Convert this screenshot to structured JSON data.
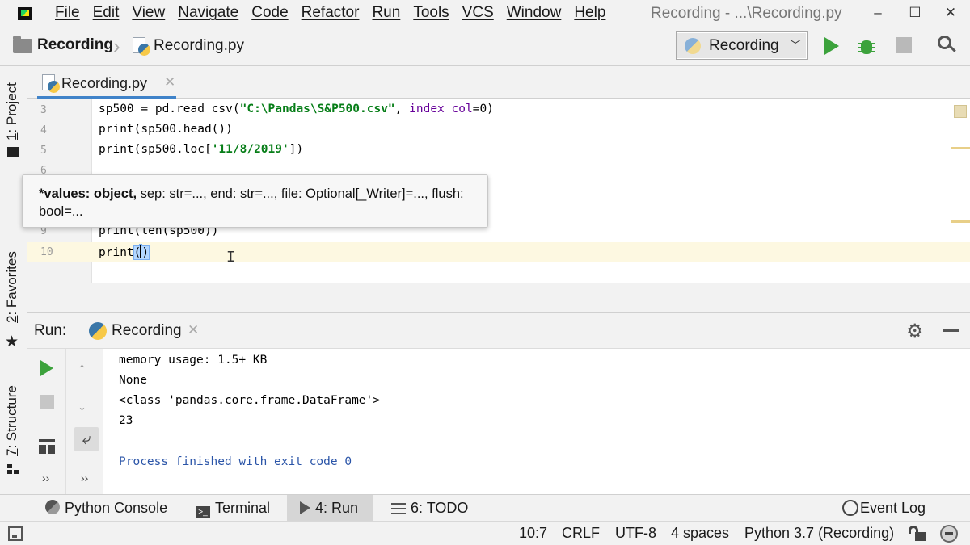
{
  "menu": {
    "items": [
      "File",
      "Edit",
      "View",
      "Navigate",
      "Code",
      "Refactor",
      "Run",
      "Tools",
      "VCS",
      "Window",
      "Help"
    ]
  },
  "window": {
    "title": "Recording - ...\\Recording.py",
    "minimize": "–",
    "maximize": "☐",
    "close": "✕"
  },
  "navbar": {
    "project": "Recording",
    "file": "Recording.py",
    "run_config": "Recording"
  },
  "left_strip": {
    "project_tab": {
      "num": "1",
      "label": ": Project"
    },
    "favorites_tab": {
      "num": "2",
      "label": ": Favorites"
    },
    "structure_tab": {
      "num": "7",
      "label": ": Structure"
    }
  },
  "editor": {
    "tab_label": "Recording.py",
    "line_numbers": [
      "3",
      "4",
      "5",
      "6",
      "",
      "",
      "9",
      "10"
    ],
    "lines": {
      "l3": {
        "pre": "sp500 = pd.read_csv(",
        "str": "\"C:\\Pandas\\S&P500.csv\"",
        "mid": ", ",
        "param": "index_col",
        "post": "=0)"
      },
      "l4": "print(sp500.head())",
      "l5": {
        "pre": "print(sp500.loc[",
        "str": "'11/8/2019'",
        "post": "])"
      },
      "l9": "print(len(sp500))",
      "l10_fn": "print",
      "l10_open": "(",
      "l10_close": ")"
    }
  },
  "param_popup": {
    "bold": "*values: object,",
    "rest": " sep: str=..., end: str=..., file: Optional[_Writer]=..., flush: bool=..."
  },
  "run_panel": {
    "label": "Run:",
    "tab": "Recording",
    "console": [
      "memory usage: 1.5+ KB",
      "None",
      "<class 'pandas.core.frame.DataFrame'>",
      "23",
      "",
      "Process finished with exit code 0"
    ]
  },
  "tool_tabs": {
    "python_console": "Python Console",
    "terminal": "Terminal",
    "run_num": "4",
    "run_label": ": Run",
    "todo_num": "6",
    "todo_label": ": TODO",
    "event_log": "Event Log"
  },
  "status": {
    "position": "10:7",
    "line_sep": "CRLF",
    "encoding": "UTF-8",
    "indent": "4 spaces",
    "interpreter": "Python 3.7 (Recording)"
  }
}
